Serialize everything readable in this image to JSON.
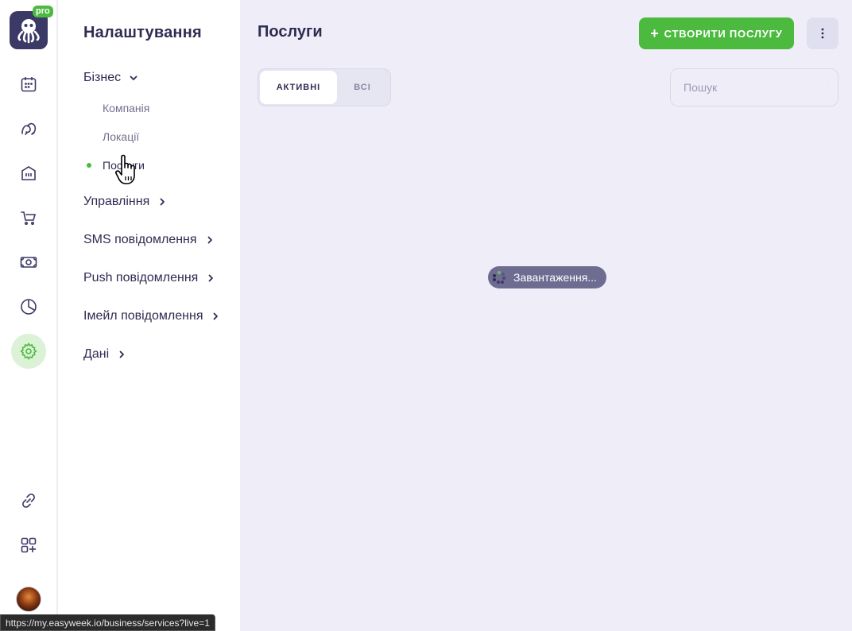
{
  "app": {
    "pro_badge": "pro"
  },
  "rail": {
    "items": [
      {
        "icon": "calendar-icon"
      },
      {
        "icon": "clients-icon"
      },
      {
        "icon": "staff-icon"
      },
      {
        "icon": "cart-icon"
      },
      {
        "icon": "money-icon"
      },
      {
        "icon": "chart-icon"
      },
      {
        "icon": "gear-icon",
        "active": true
      },
      {
        "icon": "link-icon"
      },
      {
        "icon": "apps-add-icon"
      }
    ]
  },
  "sidebar": {
    "title": "Налаштування",
    "groups": [
      {
        "label": "Бізнес",
        "expanded": true
      },
      {
        "label": "Управління"
      },
      {
        "label": "SMS повідомлення"
      },
      {
        "label": "Push повідомлення"
      },
      {
        "label": "Імейл повідомлення"
      },
      {
        "label": "Дані"
      }
    ],
    "business_items": [
      {
        "label": "Компанія"
      },
      {
        "label": "Локації"
      },
      {
        "label": "Послуги",
        "active": true
      }
    ]
  },
  "main": {
    "title": "Послуги",
    "create_button": "СТВОРИТИ ПОСЛУГУ",
    "tabs": [
      {
        "label": "АКТИВНІ",
        "active": true
      },
      {
        "label": "ВСІ"
      }
    ],
    "search_placeholder": "Пошук",
    "loading_text": "Завантаження..."
  },
  "status_bar": {
    "url": "https://my.easyweek.io/business/services?live=1"
  },
  "colors": {
    "accent_green": "#4cba3f",
    "dark_text": "#2e2c52",
    "background": "#efeef8",
    "logo_bg": "#3b3966"
  }
}
